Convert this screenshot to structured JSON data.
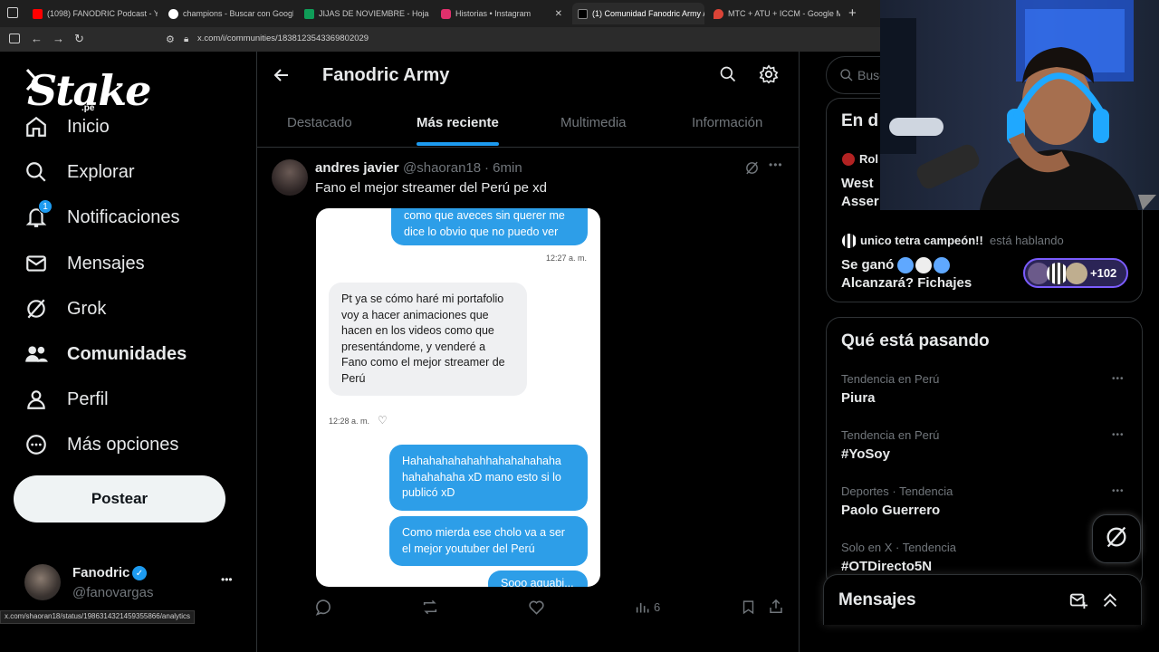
{
  "browser": {
    "tabs": [
      {
        "label": "(1098) FANODRIC Podcast - You",
        "color": "#ff0000"
      },
      {
        "label": "champions - Buscar con Google",
        "color": "#4285f4"
      },
      {
        "label": "JIJAS DE NOVIEMBRE - Hojas de",
        "color": "#0f9d58"
      },
      {
        "label": "Historias • Instagram",
        "color": "#e1306c"
      },
      {
        "label": "(1) Comunidad Fanodric Army /",
        "color": "#000000"
      },
      {
        "label": "MTC + ATU + ICCM - Google M",
        "color": "#db4437"
      }
    ],
    "url": "x.com/i/communities/1838123543369802029",
    "status_url": "x.com/shaoran18/status/1986314321459355866/analytics"
  },
  "sidebar": {
    "logo_text": "Stake",
    "logo_suffix": ".pe",
    "items": [
      {
        "label": "Inicio",
        "icon": "home-icon"
      },
      {
        "label": "Explorar",
        "icon": "search-icon"
      },
      {
        "label": "Notificaciones",
        "icon": "bell-icon",
        "badge": "1"
      },
      {
        "label": "Mensajes",
        "icon": "mail-icon"
      },
      {
        "label": "Grok",
        "icon": "grok-icon"
      },
      {
        "label": "Comunidades",
        "icon": "communities-icon"
      },
      {
        "label": "Perfil",
        "icon": "user-icon"
      },
      {
        "label": "Más opciones",
        "icon": "more-circle-icon"
      }
    ],
    "post_label": "Postear",
    "account": {
      "name": "Fanodric",
      "handle": "@fanovargas",
      "more": "•••"
    }
  },
  "main": {
    "title": "Fanodric Army",
    "tabs": [
      "Destacado",
      "Más reciente",
      "Multimedia",
      "Información"
    ],
    "active_tab": "Más reciente",
    "post": {
      "author": "andres javier",
      "handle": "@shaoran18",
      "time": "· 6min",
      "text": "Fano el mejor streamer del Perú pe xd",
      "views": "6",
      "chat": {
        "msg1": "como que aveces sin querer me dice lo obvio que no puedo ver",
        "time1": "12:27 a. m.",
        "msg2": "Pt ya se cómo haré mi portafolio voy a hacer animaciones que hacen en los videos como que presentándome, y venderé a Fano como el mejor streamer de Perú",
        "time2": "12:28 a. m.",
        "msg3": "Hahahahahahahhahahahahaha hahahahaha xD mano esto si lo publicó xD",
        "msg4": "Como mierda ese cholo va a ser el mejor youtuber del Perú",
        "msg5": "Sooo aguabi..."
      }
    }
  },
  "right": {
    "search_placeholder": "Busc",
    "live": {
      "header": "En d",
      "item1_name": "Rol",
      "item1_text1": "West",
      "item1_text2": "Asser",
      "item2_name": "unico tetra campeón!!",
      "item2_status": "está hablando",
      "item2_text1": "Se ganó",
      "item2_text2": "Alcanzará? Fichajes",
      "listeners": "+102"
    },
    "trends_title": "Qué está pasando",
    "trends": [
      {
        "category": "Tendencia en Perú",
        "name": "Piura"
      },
      {
        "category": "Tendencia en Perú",
        "name": "#YoSoy"
      },
      {
        "category": "Deportes · Tendencia",
        "name": "Paolo Guerrero"
      },
      {
        "category": "Solo en X · Tendencia",
        "name": "#OTDirecto5N"
      }
    ],
    "messages_title": "Mensajes"
  },
  "colors": {
    "accent": "#1d9bf0",
    "verified": "#1d9bf0",
    "background": "#000000"
  }
}
